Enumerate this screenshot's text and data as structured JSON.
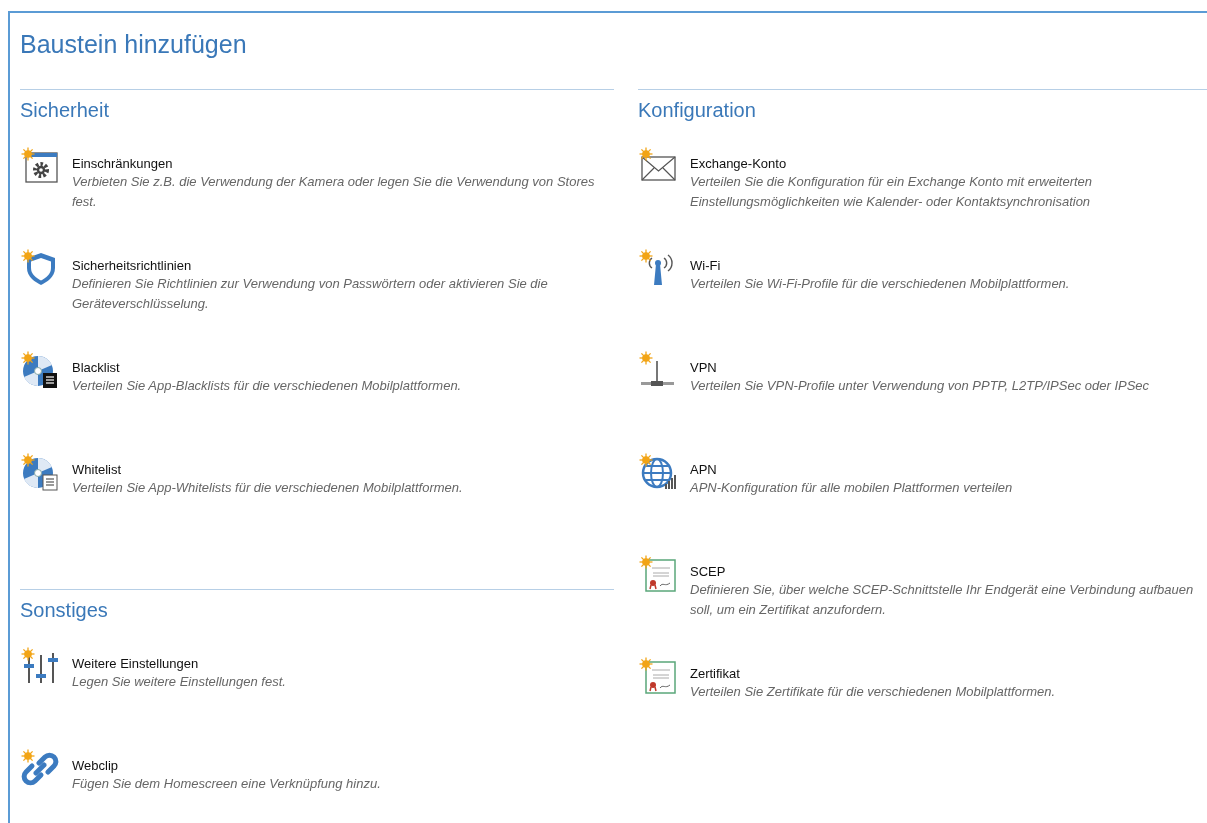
{
  "title": "Baustein hinzufügen",
  "columns": [
    {
      "sections": [
        {
          "heading": "Sicherheit",
          "items": [
            {
              "kind": "gear-window",
              "title": "Einschränkungen",
              "description": "Verbieten Sie z.B. die Verwendung der Kamera oder legen Sie die Verwendung von Stores fest."
            },
            {
              "kind": "shield",
              "title": "Sicherheitsrichtlinien",
              "description": "Definieren Sie Richtlinien zur Verwendung von Passwörtern oder aktivieren Sie die Geräteverschlüsselung."
            },
            {
              "kind": "disc-black-list",
              "title": "Blacklist",
              "description": "Verteilen Sie App-Blacklists für die verschiedenen Mobilplattformen."
            },
            {
              "kind": "disc-white-list",
              "title": "Whitelist",
              "description": "Verteilen Sie App-Whitelists für die verschiedenen Mobilplattformen."
            }
          ]
        },
        {
          "heading": "Sonstiges",
          "items": [
            {
              "kind": "sliders",
              "title": "Weitere Einstellungen",
              "description": "Legen Sie weitere Einstellungen fest."
            },
            {
              "kind": "link",
              "title": "Webclip",
              "description": "Fügen Sie dem Homescreen eine Verknüpfung hinzu."
            }
          ]
        }
      ]
    },
    {
      "sections": [
        {
          "heading": "Konfiguration",
          "items": [
            {
              "kind": "envelope",
              "title": "Exchange-Konto",
              "description": "Verteilen Sie die Konfiguration für ein Exchange Konto mit erweiterten Einstellungsmöglichkeiten wie Kalender- oder Kontaktsynchronisation"
            },
            {
              "kind": "antenna",
              "title": "Wi-Fi",
              "description": "Verteilen Sie Wi-Fi-Profile für die verschiedenen Mobilplattformen."
            },
            {
              "kind": "network",
              "title": "VPN",
              "description": "Verteilen Sie VPN-Profile unter Verwendung von PPTP, L2TP/IPSec oder IPSec"
            },
            {
              "kind": "globe",
              "title": "APN",
              "description": "APN-Konfiguration für alle mobilen Plattformen verteilen"
            },
            {
              "kind": "certificate",
              "title": "SCEP",
              "description": "Definieren Sie, über welche SCEP-Schnittstelle Ihr Endgerät eine Verbindung aufbauen soll, um ein Zertifikat anzufordern."
            },
            {
              "kind": "certificate",
              "title": "Zertifikat",
              "description": "Verteilen Sie Zertifikate für die verschiedenen Mobilplattformen."
            }
          ]
        }
      ]
    }
  ]
}
